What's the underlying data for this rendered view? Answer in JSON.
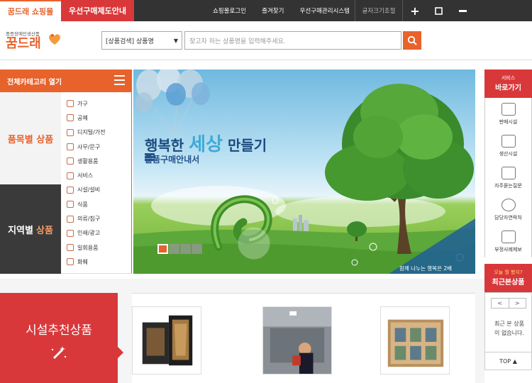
{
  "topbar": {
    "tab_shop": "꿈드래 쇼핑몰",
    "tab_guide": "우선구매제도안내",
    "links": [
      "쇼핑몰로그인",
      "즐겨찾기",
      "우선구매관리시스템"
    ],
    "font_size_label": "글자크기조절"
  },
  "header": {
    "logo_small": "중증장애인생산품",
    "logo_big": "꿈드래",
    "search_select": "[상품검색] 상품명",
    "search_placeholder": "찾고자 하는 상품명을 입력해주세요."
  },
  "category": {
    "open_label": "전체카테고리 열기",
    "by_item_label": "품목별 상품",
    "by_region_label": "지역별",
    "by_region_label_accent": "상품",
    "items": [
      "가구",
      "공예",
      "디지털/가전",
      "사무/문구",
      "생활용품",
      "서비스",
      "시설/설비",
      "식품",
      "의류/침구",
      "인쇄/광고",
      "일회용품",
      "화훼"
    ]
  },
  "banner": {
    "title_prefix": "행복한",
    "title_highlight": "세상",
    "title_suffix": "만들기",
    "org": "물품구매안내서",
    "caption": "함께 나누는 행복은 2배"
  },
  "quick": {
    "head_small": "서비스",
    "head_big": "바로가기",
    "items": [
      "판매시설",
      "생산시설",
      "자주묻는질문",
      "담당자연락처",
      "부정사례제보"
    ]
  },
  "recent": {
    "head_small": "오늘 뭘 봤지?",
    "head_big": "최근본상품",
    "prev": "<",
    "next": ">",
    "empty_text": "최근 본 상품이 없습니다.",
    "top_button": "TOP ▲"
  },
  "recommend": {
    "title": "시설추천상품"
  },
  "colors": {
    "accent_orange": "#e8622c",
    "accent_red": "#d9383a",
    "dark": "#333333"
  }
}
